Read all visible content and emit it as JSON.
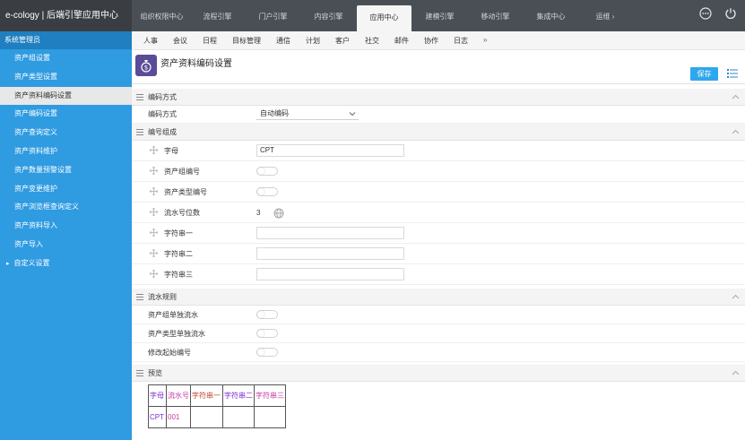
{
  "app": {
    "title": "e-cology | 后端引擎应用中心"
  },
  "topnav": {
    "items": [
      "组织权限中心",
      "流程引擎",
      "门户引擎",
      "内容引擎",
      "应用中心",
      "建模引擎",
      "移动引擎",
      "集成中心"
    ],
    "active": "应用中心",
    "more_label": "运维 ›"
  },
  "subnav": {
    "items": [
      "人事",
      "会议",
      "日程",
      "目标管理",
      "通信",
      "计划",
      "客户",
      "社交",
      "邮件",
      "协作",
      "日志"
    ],
    "more_label": "»"
  },
  "sidebar": {
    "header": "系统管理员",
    "items": [
      {
        "label": "资产组设置"
      },
      {
        "label": "资产类型设置"
      },
      {
        "label": "资产资料编码设置",
        "active": true
      },
      {
        "label": "资产编码设置"
      },
      {
        "label": "资产查询定义"
      },
      {
        "label": "资产资料维护"
      },
      {
        "label": "资产数量预警设置"
      },
      {
        "label": "资产变更维护"
      },
      {
        "label": "资产浏览框查询定义"
      },
      {
        "label": "资产资料导入"
      },
      {
        "label": "资产导入"
      },
      {
        "label": "自定义设置",
        "has_caret": true
      }
    ]
  },
  "page": {
    "title": "资产资料编码设置",
    "save_label": "保存",
    "icon": "money-bag-icon"
  },
  "sections": {
    "encoding_method": {
      "title": "编码方式",
      "label": "编码方式",
      "value": "自动编码"
    },
    "composition": {
      "title": "编号组成",
      "rows": [
        {
          "label": "字母",
          "type": "text",
          "value": "CPT"
        },
        {
          "label": "资产组编号",
          "type": "toggle"
        },
        {
          "label": "资产类型编号",
          "type": "toggle"
        },
        {
          "label": "流水号位数",
          "type": "number",
          "value": "3"
        },
        {
          "label": "字符串一",
          "type": "text",
          "value": ""
        },
        {
          "label": "字符串二",
          "type": "text",
          "value": ""
        },
        {
          "label": "字符串三",
          "type": "text",
          "value": ""
        }
      ]
    },
    "serial_rules": {
      "title": "流水规则",
      "rows": [
        {
          "label": "资产组单独流水"
        },
        {
          "label": "资产类型单独流水"
        },
        {
          "label": "修改起始编号"
        }
      ]
    },
    "preview": {
      "title": "预览",
      "headers": [
        "字母",
        "流水号",
        "字符串一",
        "字符串二",
        "字符串三"
      ],
      "values": [
        "CPT",
        "001",
        "",
        "",
        ""
      ]
    }
  },
  "colors": {
    "topbar": "#4a4f55",
    "sidebar": "#2f9be1",
    "save_button": "#2fa7ec",
    "page_icon": "#5b4c98"
  }
}
